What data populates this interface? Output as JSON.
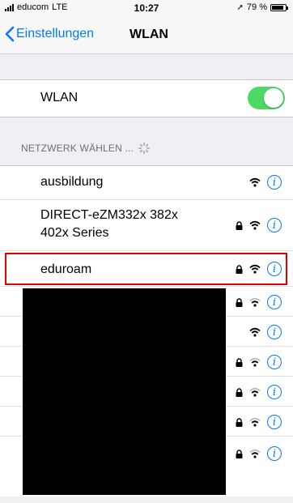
{
  "status_bar": {
    "carrier": "educom",
    "network": "LTE",
    "time": "10:27",
    "battery": "79 %"
  },
  "nav": {
    "back_label": "Einstellungen",
    "title": "WLAN"
  },
  "wifi_toggle": {
    "label": "WLAN",
    "on": true
  },
  "section": {
    "header": "NETZWERK WÄHLEN ..."
  },
  "networks": [
    {
      "name": "ausbildung",
      "locked": false
    },
    {
      "name_line1": "DIRECT-eZM332x 382x",
      "name_line2": "402x Series",
      "locked": true
    },
    {
      "name": "eduroam",
      "locked": true
    }
  ],
  "colors": {
    "accent": "#007aff",
    "toggle_on": "#4cd964",
    "highlight": "#e00000"
  }
}
